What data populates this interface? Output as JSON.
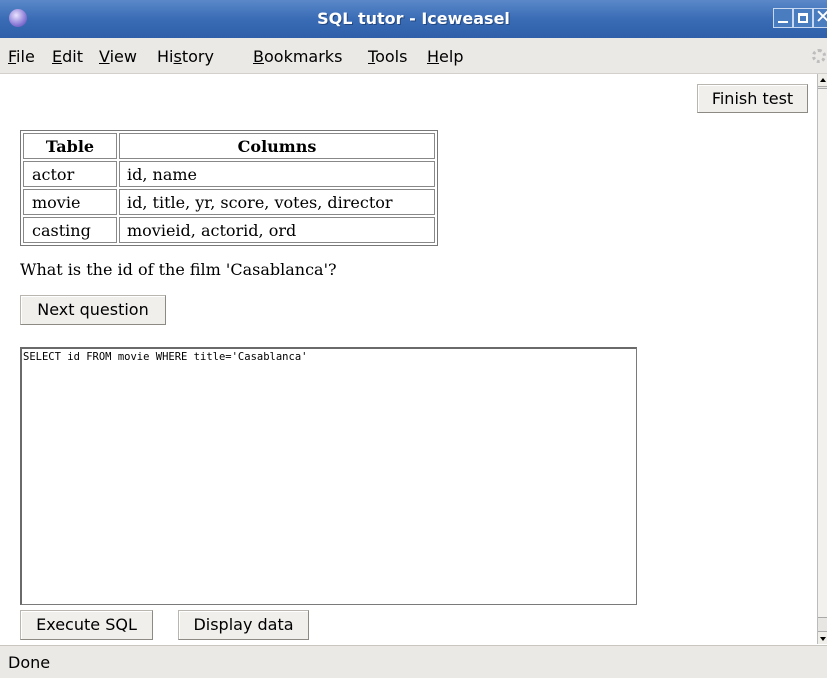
{
  "window": {
    "title": "SQL tutor - Iceweasel",
    "controls": {
      "minimize": "minimize",
      "maximize": "maximize",
      "close": "✕"
    }
  },
  "menu": [
    {
      "label": "File",
      "accel": "F",
      "rest": "ile"
    },
    {
      "label": "Edit",
      "accel": "E",
      "rest": "dit"
    },
    {
      "label": "View",
      "accel": "V",
      "rest": "iew"
    },
    {
      "label": "History",
      "pre": "Hi",
      "accel": "s",
      "rest": "tory"
    },
    {
      "label": "Bookmarks",
      "accel": "B",
      "rest": "ookmarks"
    },
    {
      "label": "Tools",
      "accel": "T",
      "rest": "ools"
    },
    {
      "label": "Help",
      "accel": "H",
      "rest": "elp"
    }
  ],
  "page": {
    "finish_button": "Finish test",
    "schema_table": {
      "headers": [
        "Table",
        "Columns"
      ],
      "rows": [
        [
          "actor",
          "id, name"
        ],
        [
          "movie",
          "id, title, yr, score, votes, director"
        ],
        [
          "casting",
          "movieid, actorid, ord"
        ]
      ]
    },
    "question": "What is the id of the film 'Casablanca'?",
    "next_button": "Next question",
    "sql_query": "SELECT id FROM movie WHERE title='Casablanca'",
    "execute_button": "Execute SQL",
    "display_button": "Display data"
  },
  "status": "Done"
}
